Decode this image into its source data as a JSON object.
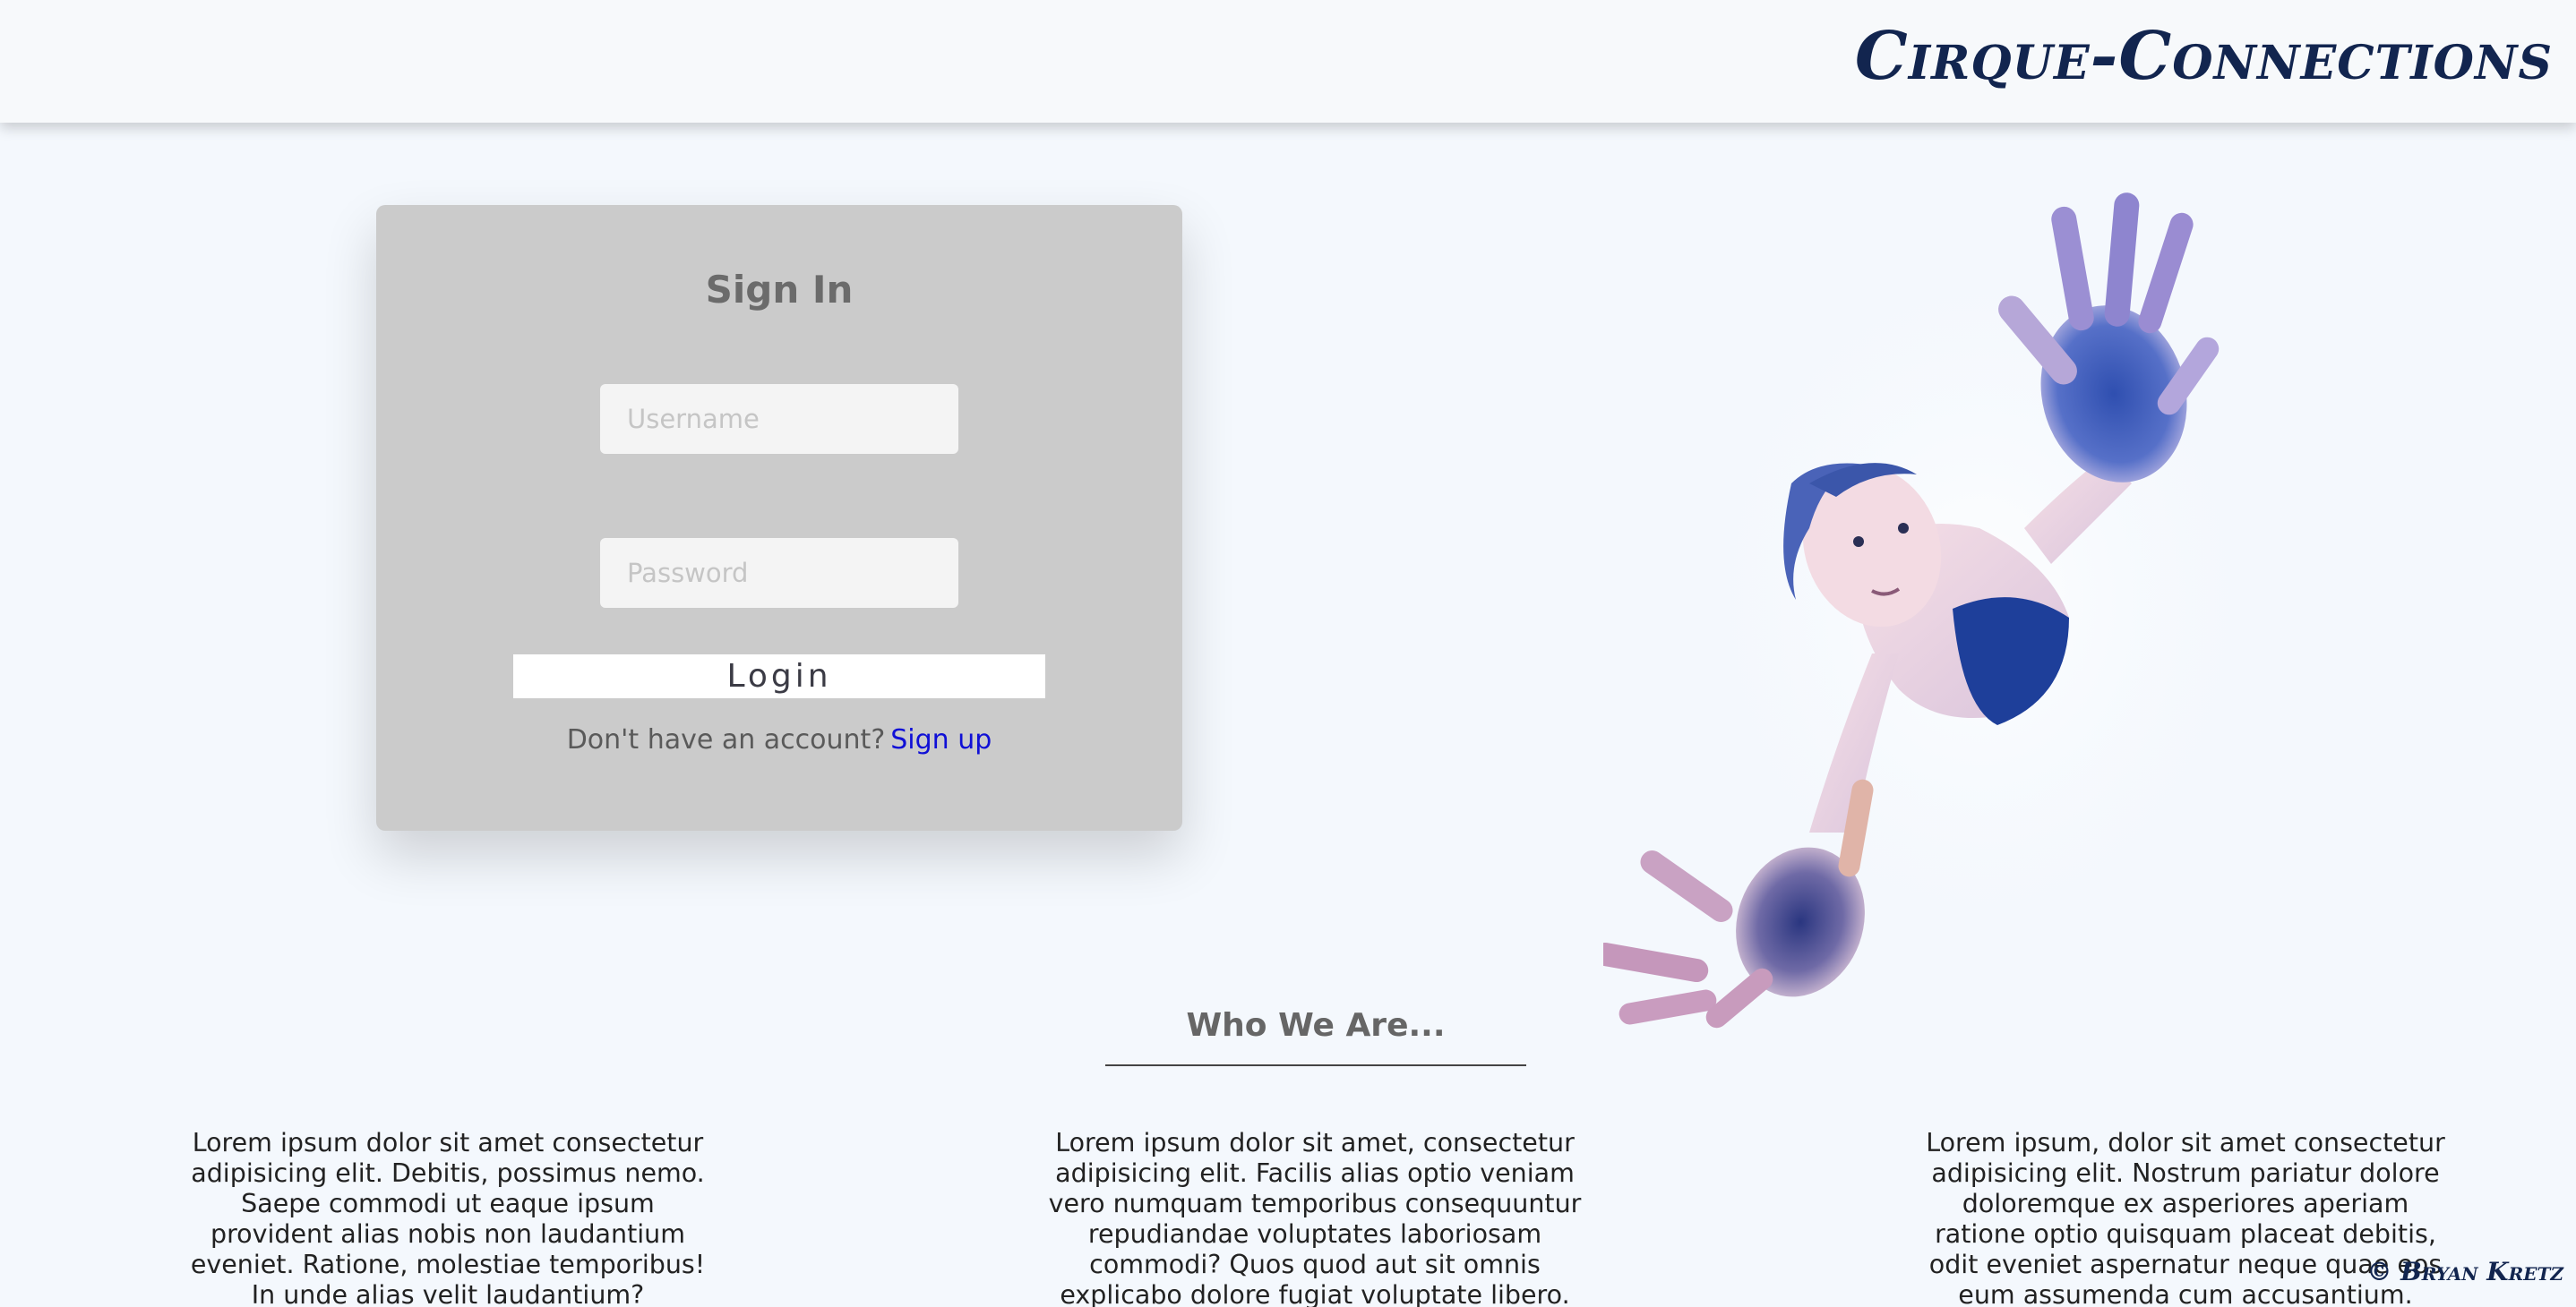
{
  "header": {
    "brand": "Cirque-Connections"
  },
  "signin": {
    "title": "Sign In",
    "username_placeholder": "Username",
    "username_value": "",
    "password_placeholder": "Password",
    "password_value": "",
    "login_label": "Login",
    "no_account_text": "Don't have an account?",
    "signup_label": "Sign up"
  },
  "hero_image": {
    "icon": "acrobat-photo"
  },
  "about": {
    "title": "Who We Are...",
    "columns": [
      "Lorem ipsum dolor sit amet consectetur adipisicing elit. Debitis, possimus nemo. Saepe commodi ut eaque ipsum provident alias nobis non laudantium eveniet. Ratione, molestiae temporibus! In unde alias velit laudantium?",
      "Lorem ipsum dolor sit amet, consectetur adipisicing elit. Facilis alias optio veniam vero numquam temporibus consequuntur repudiandae voluptates laboriosam commodi? Quos quod aut sit omnis explicabo dolore fugiat voluptate libero.",
      "Lorem ipsum, dolor sit amet consectetur adipisicing elit. Nostrum pariatur dolore doloremque ex asperiores aperiam ratione optio quisquam placeat debitis, odit eveniet aspernatur neque quae eos eum assumenda cum accusantium."
    ]
  },
  "footer": {
    "copyright": "© Bryan Kretz"
  },
  "colors": {
    "page_bg": "#f4f8fd",
    "brand": "#12254f",
    "card_bg": "#cbcbcb",
    "link": "#1010d6"
  }
}
